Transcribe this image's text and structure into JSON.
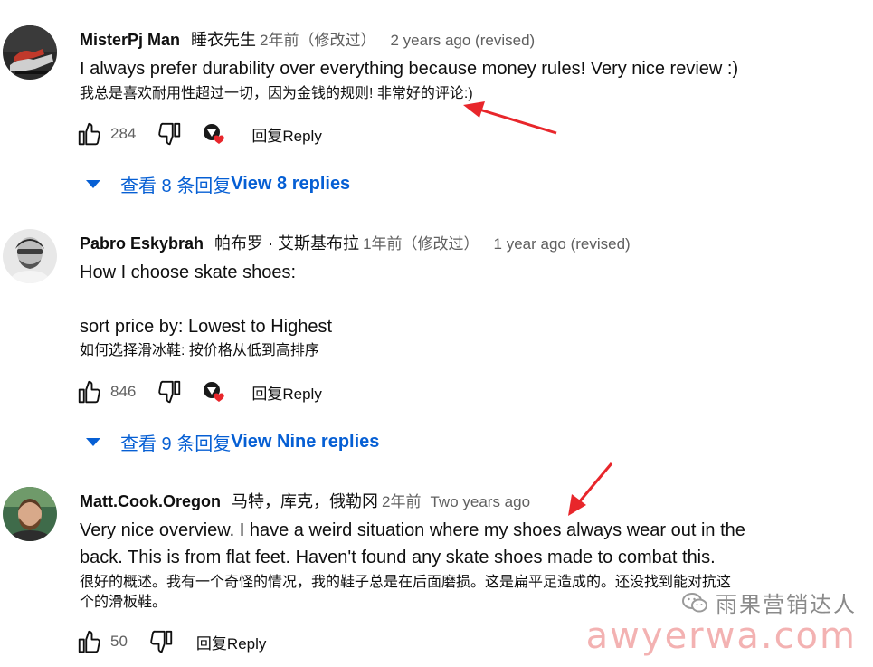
{
  "comments": [
    {
      "author": "MisterPj Man",
      "author_cn": "睡衣先生",
      "time_cn": "2年前（修改过）",
      "time_en": "2 years ago (revised)",
      "text_en": [
        "I always prefer durability over everything because money rules! Very nice review :)"
      ],
      "text_cn": [
        "我总是喜欢耐用性超过一切，因为金钱的规则! 非常好的评论:)"
      ],
      "likes": "284",
      "reply_label": "回复Reply",
      "replies_cn": "查看 8 条回复",
      "replies_en": "View 8 replies"
    },
    {
      "author": "Pabro Eskybrah",
      "author_cn": "帕布罗 · 艾斯基布拉",
      "time_cn": "1年前（修改过）",
      "time_en": "1 year ago (revised)",
      "text_en": [
        "How I choose skate shoes:",
        "",
        "sort price by: Lowest to Highest"
      ],
      "text_cn": [
        "如何选择滑冰鞋: 按价格从低到高排序"
      ],
      "likes": "846",
      "reply_label": "回复Reply",
      "replies_cn": "查看 9 条回复",
      "replies_en": "View Nine replies"
    },
    {
      "author": "Matt.Cook.Oregon",
      "author_cn": "马特，库克，俄勒冈",
      "time_cn": "2年前",
      "time_en": "Two years ago",
      "text_en": [
        "Very nice overview. I have a weird situation where my shoes always wear out in the",
        "back. This is from flat feet. Haven't found any skate shoes made to combat this."
      ],
      "text_cn": [
        "很好的概述。我有一个奇怪的情况，我的鞋子总是在后面磨损。这是扁平足造成的。还没找到能对抗这",
        "个的滑板鞋。"
      ],
      "likes": "50",
      "reply_label": "回复Reply"
    }
  ],
  "icons": {
    "like": "thumbs-up-icon",
    "dislike": "thumbs-down-icon",
    "creator_heart": "creator-heart-icon",
    "expand": "chevron-down-icon"
  },
  "colors": {
    "link_blue": "#065fd4",
    "annotation_red": "#e8262b",
    "meta_gray": "#606060"
  },
  "watermark": {
    "cn": "雨果营销达人",
    "en": "awyerwa.com"
  }
}
